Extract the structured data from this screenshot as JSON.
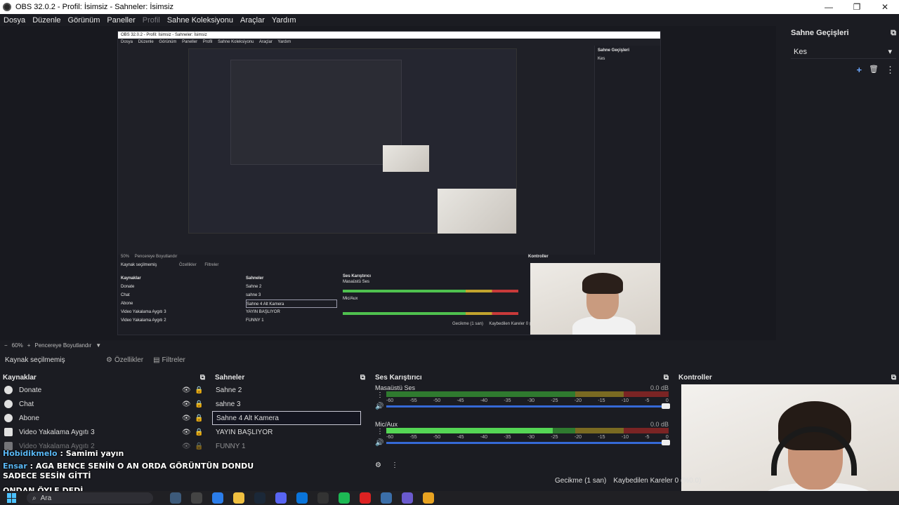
{
  "window": {
    "title": "OBS 32.0.2 - Profil: İsimsiz - Sahneler: İsimsiz",
    "minimize": "—",
    "maximize": "❐",
    "close": "✕"
  },
  "menu": {
    "items": [
      "Dosya",
      "Düzenle",
      "Görünüm",
      "Paneller",
      "Profil",
      "Sahne Koleksiyonu",
      "Araçlar",
      "Yardım"
    ],
    "disabled_index": 4
  },
  "nested": {
    "title": "OBS 32.0.2 - Profil: İsimsiz - Sahneler: İsimsiz",
    "menu": [
      "Dosya",
      "Düzenle",
      "Görünüm",
      "Paneller",
      "Profil",
      "Sahne Koleksiyonu",
      "Araçlar",
      "Yardım"
    ],
    "transitions_title": "Sahne Geçişleri",
    "transition_value": "Kes",
    "zoom": "50%",
    "fit": "Pencereye Boyutlandır",
    "no_source": "Kaynak seçilmemiş",
    "properties": "Özellikler",
    "filters": "Filtreler",
    "sources_title": "Kaynaklar",
    "sources": [
      "Donate",
      "Chat",
      "Abone",
      "Video Yakalama Aygıtı 3",
      "Video Yakalama Aygıtı 2"
    ],
    "scenes_title": "Sahneler",
    "scenes": [
      "Sahne 2",
      "sahne 3",
      "Sahne 4 Alt Kamera",
      "YAYIN BAŞLIYOR",
      "FUNNY 1"
    ],
    "mixer_title": "Ses Karıştırıcı",
    "mixer_channels": [
      "Masaüstü Ses",
      "Mic/Aux"
    ],
    "controls_title": "Kontroller",
    "status": "Gecikme (1 san)     Kaybedilen Kareler 0 (%0.0)"
  },
  "transitions_dock": {
    "title": "Sahne Geçişleri",
    "selected": "Kes",
    "add_icon": "+",
    "delete_icon": "🗑",
    "more_icon": "⋮"
  },
  "zoombar": {
    "zoom": "60%",
    "fit_label": "Pencereye Boyutlandır"
  },
  "source_status": {
    "no_source": "Kaynak seçilmemiş",
    "properties": "Özellikler",
    "filters": "Filtreler"
  },
  "sources_dock": {
    "title": "Kaynaklar",
    "items": [
      {
        "label": "Donate"
      },
      {
        "label": "Chat"
      },
      {
        "label": "Abone"
      },
      {
        "label": "Video Yakalama Aygıtı 3"
      },
      {
        "label": "Video Yakalama Aygıtı 2"
      }
    ]
  },
  "scenes_dock": {
    "title": "Sahneler",
    "items": [
      "Sahne 2",
      "sahne 3",
      "Sahne 4 Alt Kamera",
      "YAYIN BAŞLIYOR",
      "FUNNY 1"
    ],
    "active_index": 2
  },
  "mixer_dock": {
    "title": "Ses Karıştırıcı",
    "scale": [
      "-60",
      "-55",
      "-50",
      "-45",
      "-40",
      "-35",
      "-30",
      "-25",
      "-20",
      "-15",
      "-10",
      "-5",
      "0"
    ],
    "channels": [
      {
        "name": "Masaüstü Ses",
        "db": "0.0 dB",
        "level": 0.0,
        "fader": 1.0
      },
      {
        "name": "Mic/Aux",
        "db": "0.0 dB",
        "level": 0.59,
        "fader": 1.0
      }
    ]
  },
  "controls_dock": {
    "title": "Kontroller"
  },
  "chat": {
    "line1_name": "Hobidikmelo",
    "line1_text": ": Samimi yayın",
    "line2_name": "Ensar",
    "line2_text": ": AGA BENCE SENİN O AN ORDA GÖRÜNTÜN DONDU SADECE SESİN GİTTİ",
    "line3_text": "ONDAN ÖYLE DEDİ"
  },
  "status": {
    "delay": "Gecikme (1 san)",
    "dropped": "Kaybedilen Kareler 0 (%0.0)"
  },
  "taskbar": {
    "search_placeholder": "Ara",
    "apps": [
      "widget",
      "task-view",
      "copilot",
      "file-explorer",
      "steam",
      "discord",
      "store",
      "obs",
      "spotify",
      "app-red",
      "app-blue",
      "app-purple",
      "chrome"
    ],
    "app_colors": [
      "#3d5a7a",
      "#444",
      "#2b7de9",
      "#f0c040",
      "#1b2838",
      "#5865f2",
      "#0a74da",
      "#333",
      "#1db954",
      "#d22",
      "#3b6ea8",
      "#6a5acd",
      "#e8a321"
    ]
  }
}
